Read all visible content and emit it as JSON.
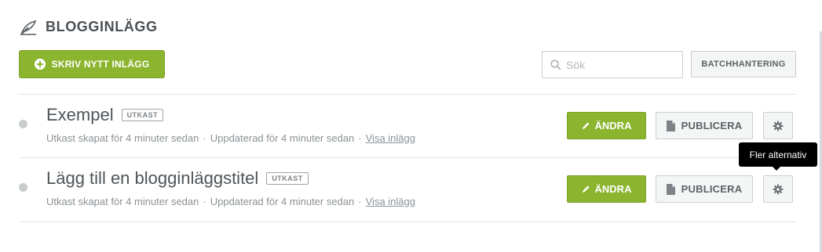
{
  "header": {
    "title": "BLOGGINLÄGG",
    "icon": "feather-icon"
  },
  "toolbar": {
    "new_post_label": "SKRIV NYTT INLÄGG",
    "search_placeholder": "Sök",
    "search_value": "",
    "batch_label": "BATCHHANTERING"
  },
  "posts": [
    {
      "title": "Exempel",
      "status": "UTKAST",
      "created": "Utkast skapat för 4 minuter sedan",
      "updated": "Uppdaterad för 4 minuter sedan",
      "view_link": "Visa inlägg",
      "sep": "·",
      "edit_label": "ÄNDRA",
      "publish_label": "PUBLICERA"
    },
    {
      "title": "Lägg till en blogginläggstitel",
      "status": "UTKAST",
      "created": "Utkast skapat för 4 minuter sedan",
      "updated": "Uppdaterad för 4 minuter sedan",
      "view_link": "Visa inlägg",
      "sep": "·",
      "edit_label": "ÄNDRA",
      "publish_label": "PUBLICERA"
    }
  ],
  "tooltip": {
    "text": "Fler alternativ"
  },
  "colors": {
    "accent": "#8bb52f",
    "text": "#4e5458",
    "muted": "#8b9195"
  }
}
